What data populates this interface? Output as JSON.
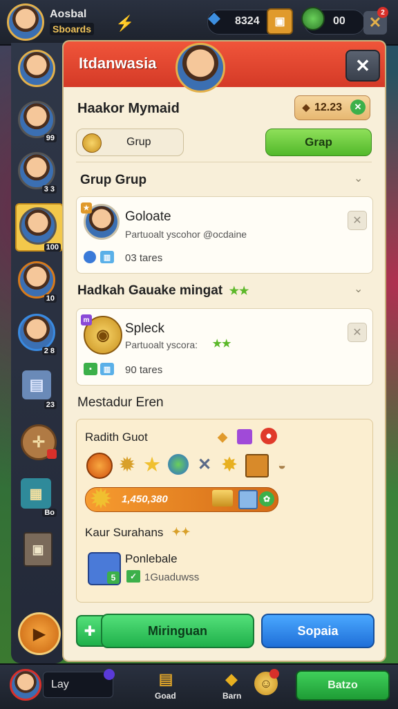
{
  "header": {
    "player_name": "Aosbal",
    "player_sub": "Sboards",
    "gems": "8324",
    "coins": "00",
    "notification": "2"
  },
  "sidebar": {
    "items": [
      {
        "label": ""
      },
      {
        "label": "99"
      },
      {
        "label": "3 3"
      },
      {
        "label": "100"
      },
      {
        "label": "10"
      },
      {
        "label": "2 8"
      },
      {
        "label": "23"
      },
      {
        "label": ""
      },
      {
        "label": "Bo"
      },
      {
        "label": ""
      }
    ]
  },
  "panel": {
    "title": "Itdanwasia",
    "close": "✕",
    "section_title": "Haakor Mymaid",
    "balance": "12.23",
    "group_light_btn": "Grup",
    "group_green_btn": "Grap",
    "group_header": "Grup Grup",
    "card1": {
      "title": "Goloate",
      "subtitle": "Partuoalt yscohor @ocdaine",
      "meta": "03 tares"
    },
    "mid_header": "Hadkah Gauake mingat",
    "card2": {
      "title": "Spleck",
      "subtitle": "Partuoalt yscora:",
      "meta": "90 tares"
    },
    "reward_header": "Mestadur Eren",
    "reward": {
      "row_title": "Radith Guot",
      "bar_value": "1,450,380",
      "sub_title": "Kaur Surahans",
      "item_title": "Ponlebale",
      "item_sub": "1Guaduwss",
      "item_badge": "5"
    },
    "cta_primary": "Miringuan",
    "cta_secondary": "Sopaia"
  },
  "bottom": {
    "input_text": "Lay",
    "shop_label": "Goad",
    "event_label": "Barn",
    "main_btn": "Batzo"
  }
}
